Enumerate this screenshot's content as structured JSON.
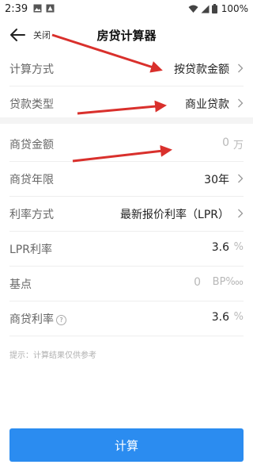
{
  "status_bar": {
    "time": "2:39",
    "battery": "100%"
  },
  "header": {
    "close_label": "关闭",
    "title": "房贷计算器"
  },
  "form": {
    "calc_method": {
      "label": "计算方式",
      "value": "按贷款金额"
    },
    "loan_type": {
      "label": "贷款类型",
      "value": "商业贷款"
    },
    "loan_amount": {
      "label": "商贷金额",
      "value": "0",
      "unit": "万"
    },
    "loan_term": {
      "label": "商贷年限",
      "value": "30年"
    },
    "rate_method": {
      "label": "利率方式",
      "value": "最新报价利率（LPR）"
    },
    "lpr_rate": {
      "label": "LPR利率",
      "value": "3.6",
      "unit": "%"
    },
    "basis_point": {
      "label": "基点",
      "value": "0",
      "unit": "BP‱"
    },
    "commercial_rate": {
      "label": "商贷利率",
      "value": "3.6",
      "unit": "%"
    }
  },
  "hint": "提示：计算结果仅供参考",
  "button": {
    "calculate_label": "计算"
  },
  "colors": {
    "primary": "#2b8cf0",
    "annotation_arrow": "#d9302c",
    "placeholder": "#b8b8b8"
  },
  "icons": [
    "image-icon",
    "image-icon",
    "android-icon",
    "wifi-icon",
    "signal-icon",
    "battery-icon",
    "back-arrow-icon",
    "chevron-right-icon",
    "help-icon"
  ]
}
